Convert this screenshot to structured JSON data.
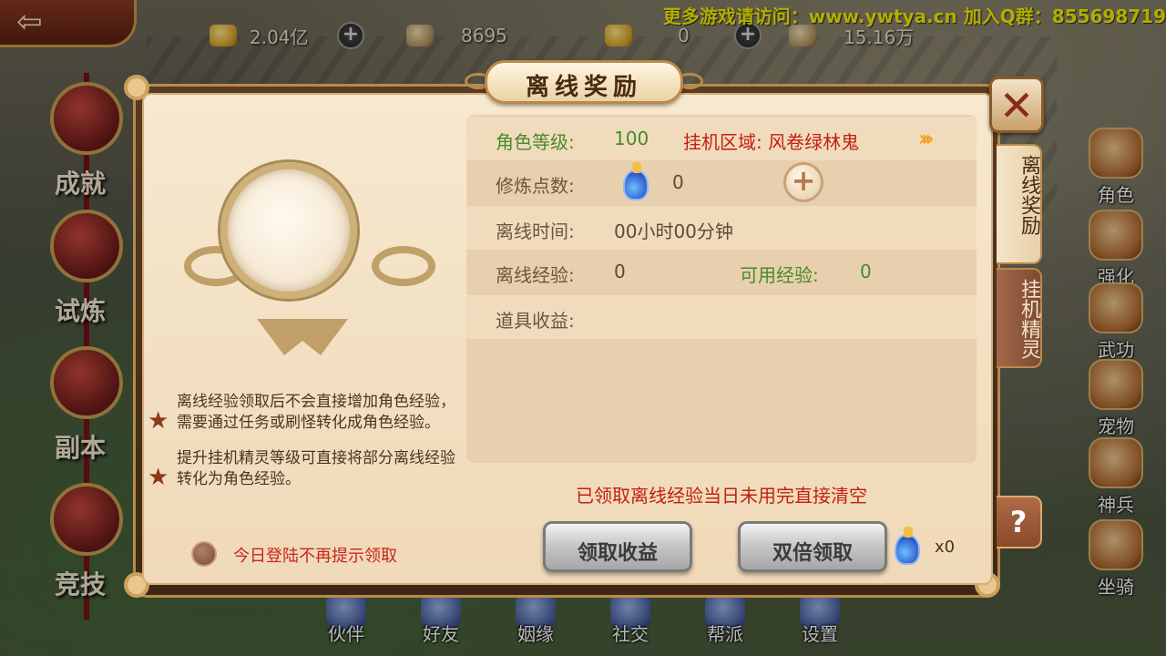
{
  "hud": {
    "resources": [
      {
        "icon": "gold-ingot-icon",
        "value": "2.04亿"
      },
      {
        "icon": "locked-ingot-icon",
        "value": "8695"
      },
      {
        "icon": "coin-icon",
        "value": "0"
      },
      {
        "icon": "locked-coin-icon",
        "value": "15.16万"
      }
    ],
    "watermark": "更多游戏请访问：www.ywtya.cn  加入Q群：855698719"
  },
  "left_menu": [
    "成就",
    "试炼",
    "副本",
    "竞技"
  ],
  "right_menu": [
    "角色",
    "强化",
    "武功",
    "宠物",
    "神兵",
    "坐骑"
  ],
  "bottom_menu": [
    "伙伴",
    "好友",
    "姻缘",
    "社交",
    "帮派",
    "设置"
  ],
  "dialog": {
    "title": "离线奖励",
    "close_icon": "close-x-icon",
    "tabs": [
      "离线奖励",
      "挂机精灵"
    ],
    "help_label": "?",
    "tips": [
      "离线经验领取后不会直接增加角色经验，需要通过任务或刷怪转化成角色经验。",
      "提升挂机精灵等级可直接将部分离线经验转化为角色经验。"
    ],
    "no_remind_label": "今日登陆不再提示领取",
    "info": {
      "level_label": "角色等级:",
      "level_value": "100",
      "area_label": "挂机区域: 风卷绿林鬼",
      "cultivation_label": "修炼点数:",
      "cultivation_value": "0",
      "offline_time_label": "离线时间:",
      "offline_time_value": "00小时00分钟",
      "offline_exp_label": "离线经验:",
      "offline_exp_value": "0",
      "usable_exp_label": "可用经验:",
      "usable_exp_value": "0",
      "item_income_label": "道具收益:"
    },
    "warning": "已领取离线经验当日未用完直接清空",
    "claim_button": "领取收益",
    "double_claim_button": "双倍领取",
    "potion_count": "x0"
  },
  "colors": {
    "panel_bg": "#f7e8cf",
    "accent_red": "#c41e12",
    "accent_green": "#4a8a2a",
    "frame_brown": "#3d2716"
  }
}
